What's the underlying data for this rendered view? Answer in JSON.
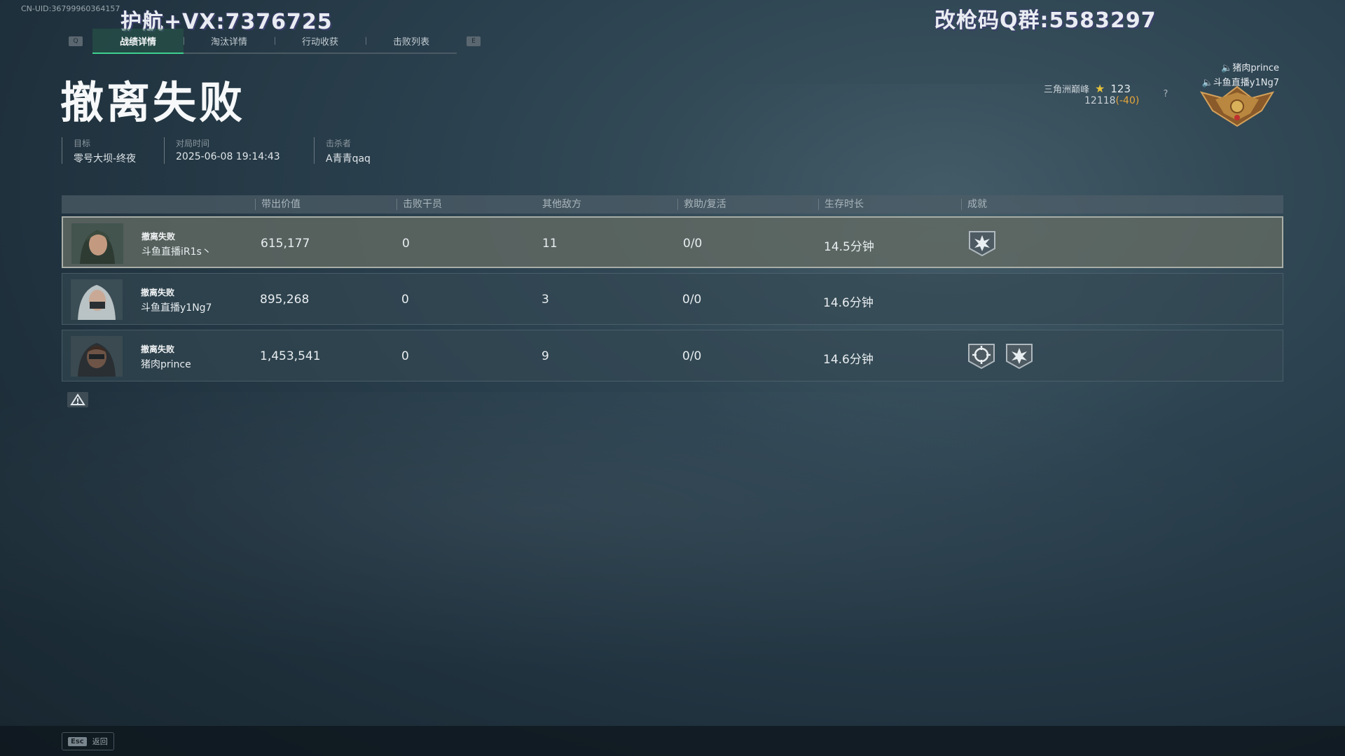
{
  "uid_text": "CN-UID:36799960364157",
  "watermark_left": "护航+VX:7376725",
  "watermark_right": "改枪码Q群:5583297",
  "tabs": {
    "prev_key": "Q",
    "next_key": "E",
    "items": [
      {
        "label": "战绩详情"
      },
      {
        "label": "淘汰详情"
      },
      {
        "label": "行动收获"
      },
      {
        "label": "击败列表"
      }
    ]
  },
  "title": "撤离失败",
  "info": {
    "target_label": "目标",
    "target_value": "零号大坝-终夜",
    "time_label": "对局时间",
    "time_value": "2025-06-08 19:14:43",
    "killer_label": "击杀者",
    "killer_value": "A青青qaq"
  },
  "rank": {
    "name": "三角洲巅峰",
    "stars": "123",
    "score": "12118",
    "delta": "(-40)",
    "help": "?"
  },
  "voice_players": [
    "猪肉prince",
    "斗鱼直播y1Ng7"
  ],
  "table": {
    "headers": [
      "带出价值",
      "击败干员",
      "其他敌方",
      "救助/复活",
      "生存时长",
      "成就"
    ],
    "rows": [
      {
        "status": "撤离失败",
        "name": "斗鱼直播iR1s丶",
        "value": "615,177",
        "kills": "0",
        "other": "11",
        "assist": "0/0",
        "survival": "14.5分钟"
      },
      {
        "status": "撤离失败",
        "name": "斗鱼直播y1Ng7",
        "value": "895,268",
        "kills": "0",
        "other": "3",
        "assist": "0/0",
        "survival": "14.6分钟"
      },
      {
        "status": "撤离失败",
        "name": "猪肉prince",
        "value": "1,453,541",
        "kills": "0",
        "other": "9",
        "assist": "0/0",
        "survival": "14.6分钟"
      }
    ]
  },
  "footer": {
    "esc_key": "Esc",
    "esc_label": "返回"
  }
}
